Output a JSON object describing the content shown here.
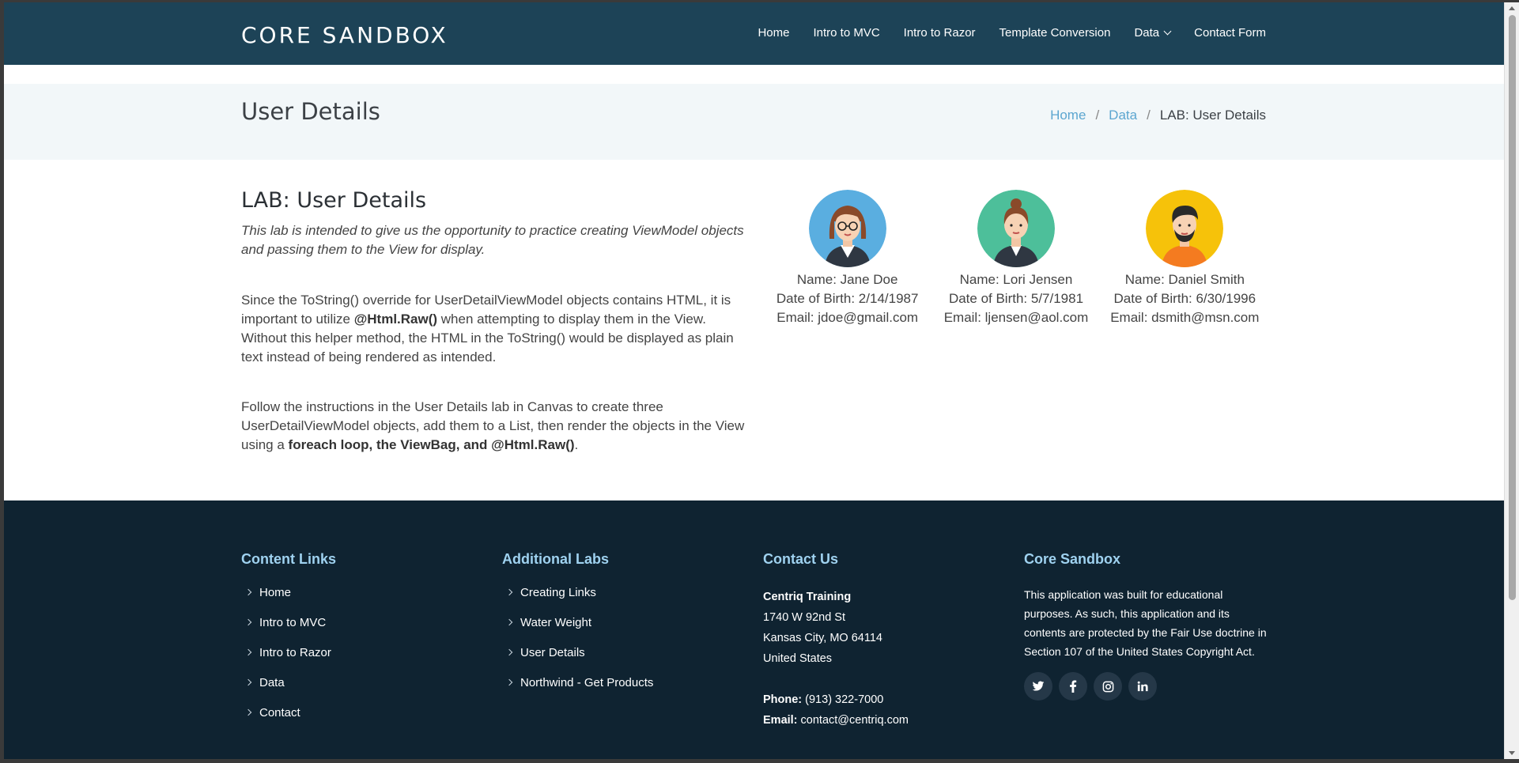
{
  "brand": "CORE SANDBOX",
  "nav": {
    "items": [
      {
        "label": "Home"
      },
      {
        "label": "Intro to MVC"
      },
      {
        "label": "Intro to Razor"
      },
      {
        "label": "Template Conversion"
      },
      {
        "label": "Data",
        "dropdown": true
      },
      {
        "label": "Contact Form"
      }
    ]
  },
  "page_title": "User Details",
  "breadcrumb": {
    "items": [
      "Home",
      "Data"
    ],
    "separator": "/",
    "current": "LAB: User Details"
  },
  "lab": {
    "title": "LAB: User Details",
    "intro": "This lab is intended to give us the opportunity to practice creating ViewModel objects and passing them to the View for display.",
    "p1_a": "Since the ToString() override for UserDetailViewModel objects contains HTML, it is important to utilize ",
    "p1_b": "@Html.Raw()",
    "p1_c": " when attempting to display them in the View. Without this helper method, the HTML in the ToString() would be displayed as plain text instead of being rendered as intended.",
    "p2_a": "Follow the instructions in the User Details lab in Canvas to create three UserDetailViewModel objects, add them to a List, then render the objects in the View using a ",
    "p2_b": "foreach loop, the ViewBag, and @Html.Raw()",
    "p2_c": "."
  },
  "users": [
    {
      "name": "Name: Jane Doe",
      "dob": "Date of Birth: 2/14/1987",
      "email": "Email: jdoe@gmail.com",
      "avatar_color": "#5aaee0",
      "avatar_icon": "woman-glasses-avatar"
    },
    {
      "name": "Name: Lori Jensen",
      "dob": "Date of Birth: 5/7/1981",
      "email": "Email: ljensen@aol.com",
      "avatar_color": "#4dbf9a",
      "avatar_icon": "woman-bun-avatar"
    },
    {
      "name": "Name: Daniel Smith",
      "dob": "Date of Birth: 6/30/1996",
      "email": "Email: dsmith@msn.com",
      "avatar_color": "#f6c20a",
      "avatar_icon": "man-beard-avatar"
    }
  ],
  "footer": {
    "content_links": {
      "heading": "Content Links",
      "items": [
        "Home",
        "Intro to MVC",
        "Intro to Razor",
        "Data",
        "Contact"
      ]
    },
    "additional_labs": {
      "heading": "Additional Labs",
      "items": [
        "Creating Links",
        "Water Weight",
        "User Details",
        "Northwind - Get Products"
      ]
    },
    "contact": {
      "heading": "Contact Us",
      "org": "Centriq Training",
      "address1": "1740 W 92nd St",
      "address2": "Kansas City, MO 64114",
      "country": "United States",
      "phone_label": "Phone:",
      "phone": " (913) 322-7000",
      "email_label": "Email:",
      "email": " contact@centriq.com"
    },
    "about": {
      "heading": "Core Sandbox",
      "text": "This application was built for educational purposes. As such, this application and its contents are protected by the Fair Use doctrine in Section 107 of the United States Copyright Act.",
      "socials": [
        "twitter-icon",
        "facebook-icon",
        "instagram-icon",
        "linkedin-icon"
      ]
    }
  }
}
